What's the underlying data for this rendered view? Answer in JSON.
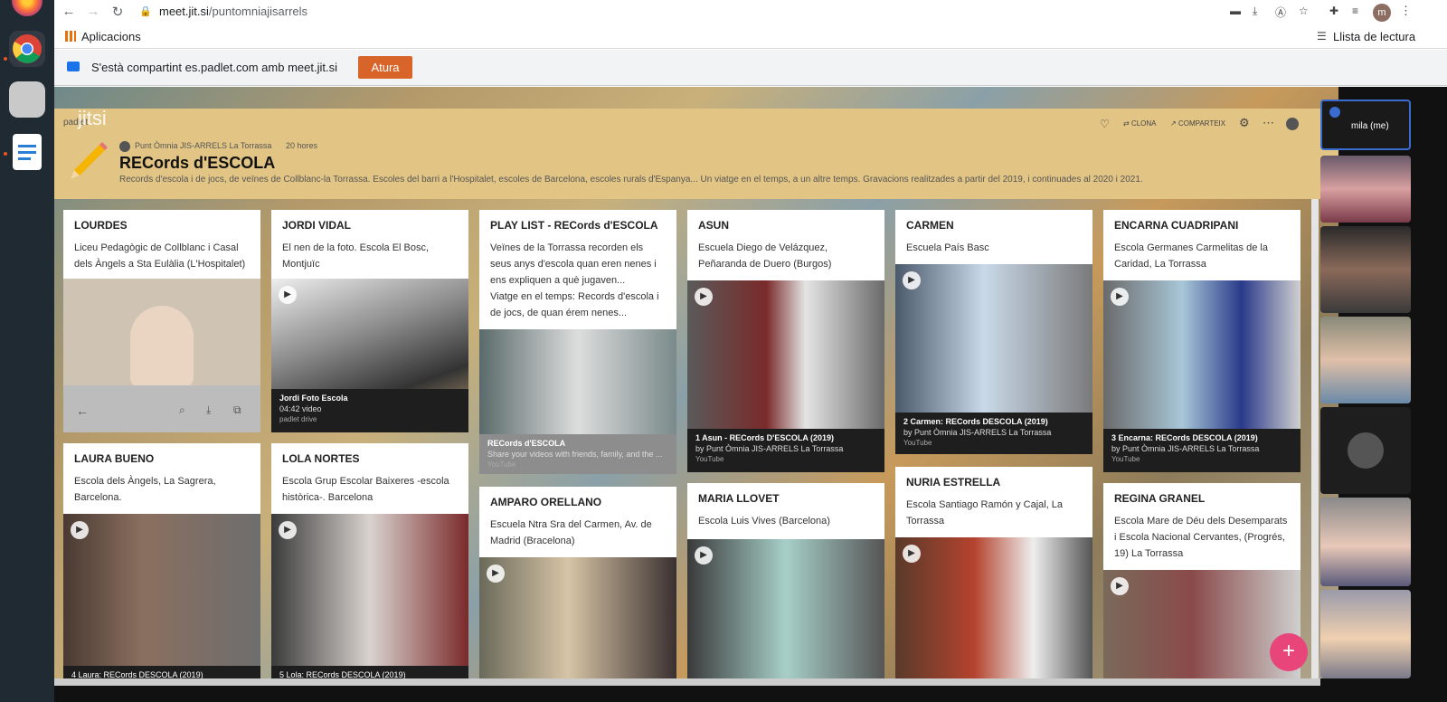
{
  "browser": {
    "url_domain": "meet.jit.si",
    "url_path": "/puntomniajisarrels",
    "profile_initial": "m",
    "bookmark_apps": "Aplicacions",
    "reading_list": "Llista de lectura"
  },
  "share_bar": {
    "message": "S'està compartint es.padlet.com amb meet.jit.si",
    "stop_label": "Atura"
  },
  "jitsi": {
    "watermark": "jitsi",
    "self_label": "mila (me)"
  },
  "padlet": {
    "brand": "padlet",
    "author": "Punt Òmnia JIS-ARRELS La Torrassa",
    "time": "20 hores",
    "title": "RECords d'ESCOLA",
    "description": "Records d'escola i de jocs, de veïnes de Collblanc-la Torrassa. Escoles del barri a l'Hospitalet, escoles de Barcelona, escoles rurals d'Espanya... Un viatge en el temps, a un altre temps. Gravacions realitzades a partir del 2019, i continuades al 2020 i 2021.",
    "actions": {
      "clone": "CLONA",
      "share": "COMPARTEIX"
    },
    "cards": [
      {
        "title": "LOURDES",
        "desc": "Liceu Pedagògic de Collblanc i Casal dels Àngels a Sta Eulàlia (L'Hospitalet)"
      },
      {
        "title": "JORDI VIDAL",
        "desc": "El nen de la foto. Escola El Bosc, Montjuïc",
        "cap_title": "Jordi Foto Escola",
        "cap_sub": "04:42 video",
        "cap_src": "padlet drive"
      },
      {
        "title": "PLAY LIST - RECords d'ESCOLA",
        "desc": "Veïnes de la Torrassa recorden els seus anys d'escola quan eren nenes i ens expliquen a què jugaven...",
        "desc2": "Viatge en el temps: Records d'escola i de jocs, de quan érem nenes...",
        "cap_title": "RECords d'ESCOLA",
        "cap_sub": "Share your videos with friends, family, and the ...",
        "cap_src": "YouTube"
      },
      {
        "title": "ASUN",
        "desc": "Escuela Diego de Velázquez,  Peñaranda de Duero (Burgos)",
        "cap_title": "1 Asun - RECords D'ESCOLA (2019)",
        "cap_sub": "by Punt Òmnia JIS-ARRELS La Torrassa",
        "cap_src": "YouTube"
      },
      {
        "title": "CARMEN",
        "desc": "Escuela País Basc",
        "cap_title": "2 Carmen: RECords DESCOLA (2019)",
        "cap_sub": "by Punt Òmnia JIS-ARRELS La Torrassa",
        "cap_src": "YouTube"
      },
      {
        "title": "ENCARNA CUADRIPANI",
        "desc": "Escola Germanes Carmelitas de la Caridad, La Torrassa",
        "cap_title": "3 Encarna: RECords DESCOLA (2019)",
        "cap_sub": "by Punt Òmnia JIS-ARRELS La Torrassa",
        "cap_src": "YouTube"
      },
      {
        "title": "LAURA BUENO",
        "desc": "Escola dels Àngels, La Sagrera, Barcelona.",
        "cap_title": "4 Laura: RECords DESCOLA (2019)"
      },
      {
        "title": "LOLA NORTES",
        "desc": "Escola Grup Escolar Baixeres -escola històrica-. Barcelona",
        "cap_title": "5 Lola: RECords DESCOLA (2019)"
      },
      {
        "title": "AMPARO ORELLANO",
        "desc": "Escuela Ntra Sra del Carmen,  Av. de Madrid (Bracelona)"
      },
      {
        "title": "MARIA LLOVET",
        "desc": "Escola Luis Vives (Barcelona)"
      },
      {
        "title": "NURIA ESTRELLA",
        "desc": "Escola Santiago Ramón y Cajal, La Torrassa"
      },
      {
        "title": "REGINA GRANEL",
        "desc": "Escola Mare de Déu dels Desemparats i Escola Nacional Cervantes, (Progrés, 19) La Torrassa"
      }
    ],
    "fab": "+"
  },
  "colors": {
    "accent": "#d9642a",
    "header_bg": "#e2c585",
    "fab": "#e8457a"
  }
}
